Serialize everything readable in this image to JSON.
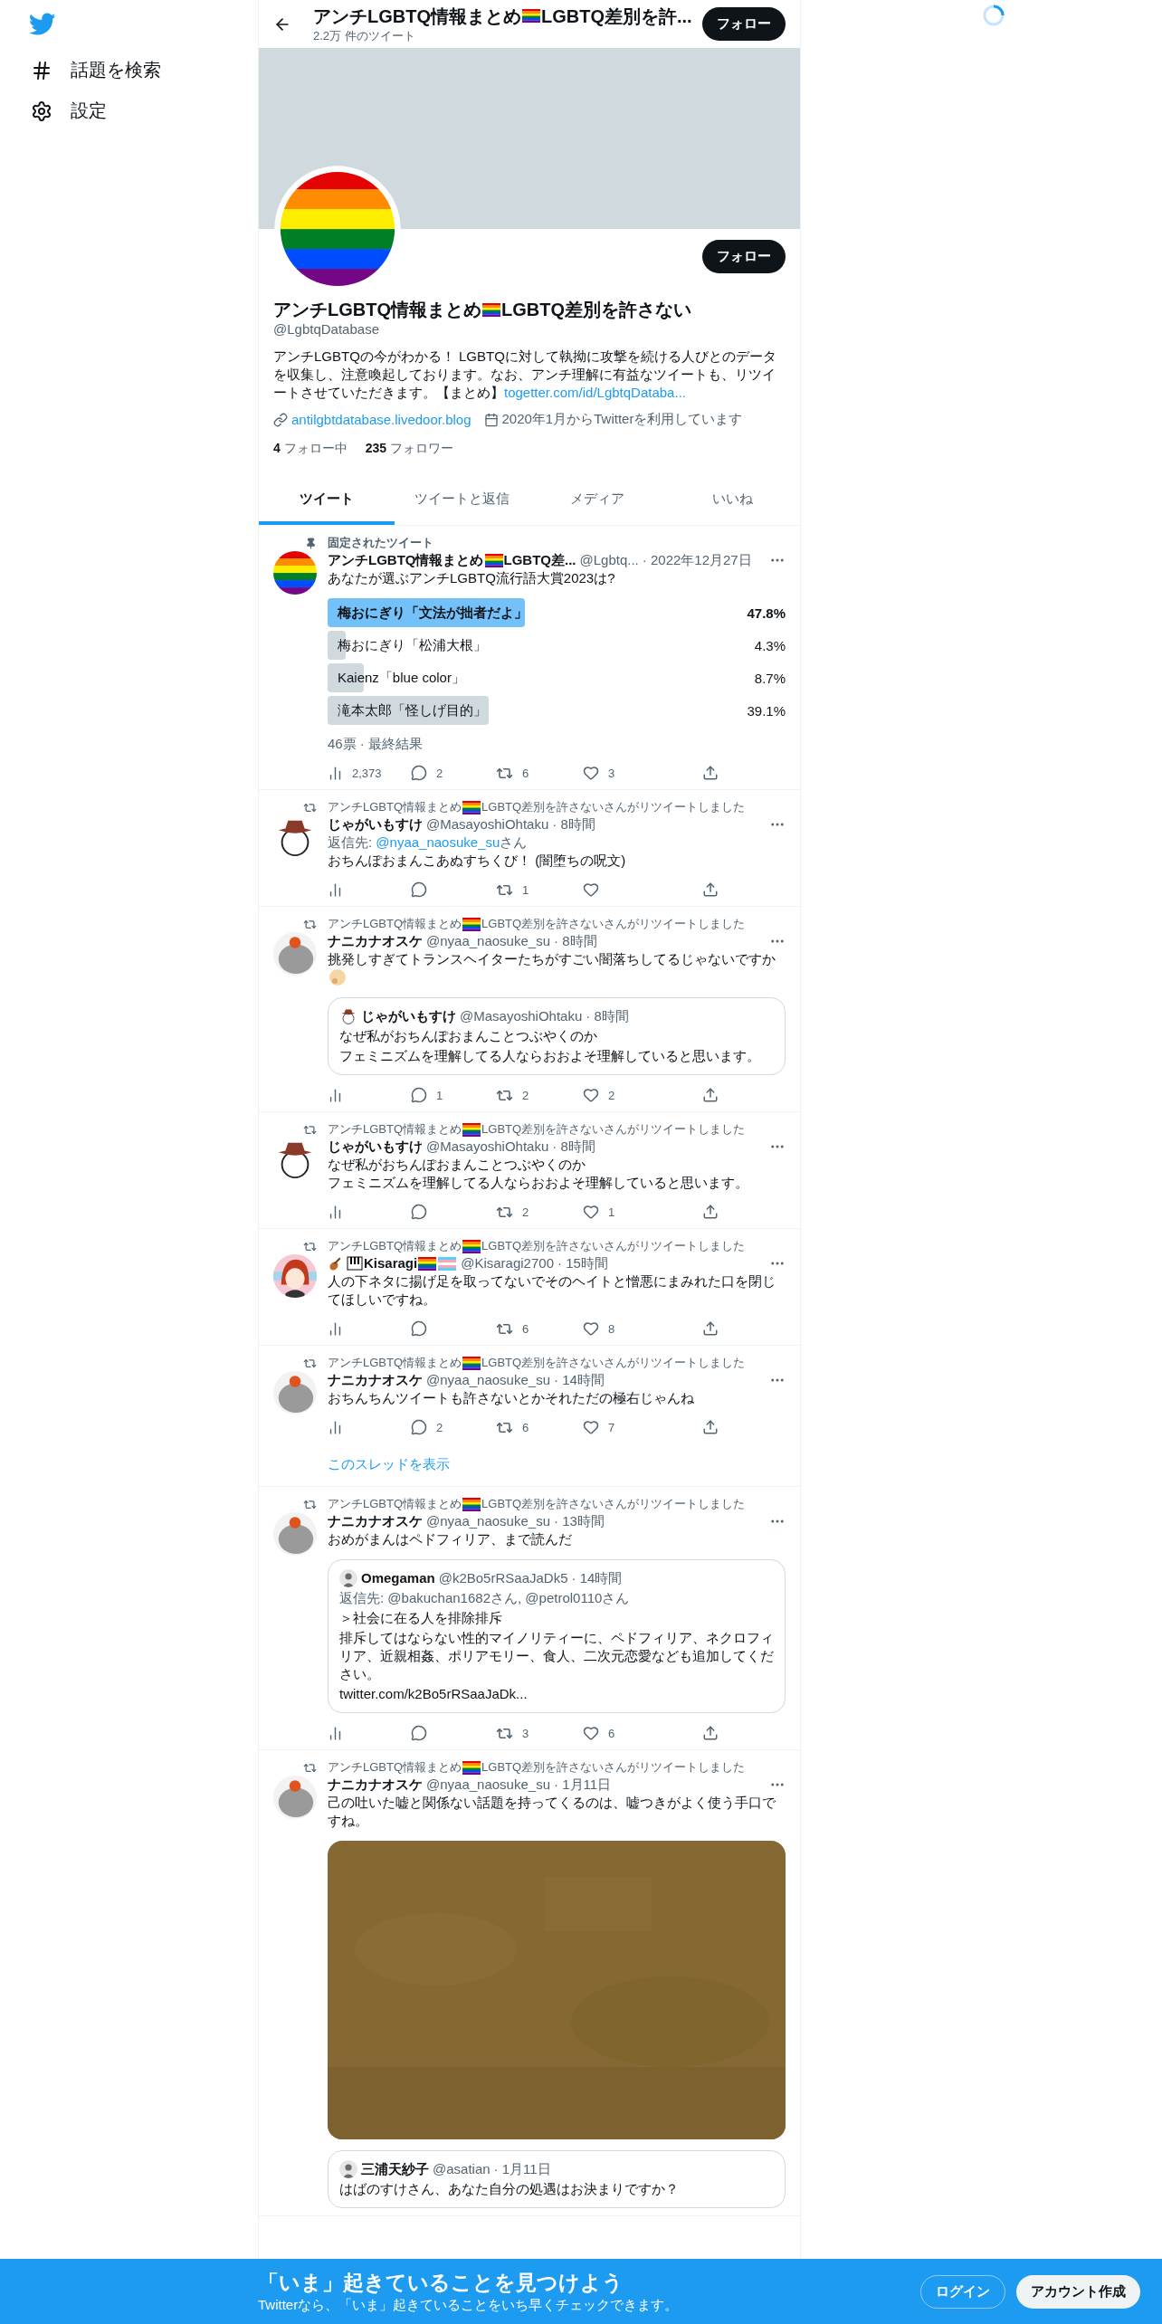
{
  "sidebar": {
    "items": [
      {
        "kind": "hash",
        "label": "話題を検索"
      },
      {
        "kind": "gear",
        "label": "設定"
      }
    ]
  },
  "header": {
    "title": [
      "アンチLGBTQ情報まとめ",
      {
        "kind": "rainbow-flag"
      },
      "LGBTQ差別を許..."
    ],
    "subtitle": "2.2万 件のツイート",
    "follow": "フォロー"
  },
  "profile": {
    "follow": "フォロー",
    "name": [
      "アンチLGBTQ情報まとめ",
      {
        "kind": "rainbow-flag"
      },
      "LGBTQ差別を許さない"
    ],
    "handle": "@LgbtqDatabase",
    "bio": "アンチLGBTQの今がわかる！ LGBTQに対して執拗に攻撃を続ける人びとのデータを収集し、注意喚起しております。なお、アンチ理解に有益なツイートも、リツイートさせていただきます。【まとめ】",
    "bio_link": "togetter.com/id/LgbtqDataba...",
    "website": "antilgbtdatabase.livedoor.blog",
    "joined": "2020年1月からTwitterを利用しています",
    "stats": [
      {
        "count": "4",
        "label": "フォロー中"
      },
      {
        "count": "235",
        "label": "フォロワー"
      }
    ]
  },
  "tabs": [
    {
      "label": "ツイート",
      "selected": true
    },
    {
      "label": "ツイートと返信",
      "selected": false
    },
    {
      "label": "メディア",
      "selected": false
    },
    {
      "label": "いいね",
      "selected": false
    }
  ],
  "tweets": [
    {
      "context": {
        "kind": "pinned",
        "label": [
          "固定されたツイート"
        ]
      },
      "avatar": {
        "kind": "rainbow"
      },
      "name": [
        "アンチLGBTQ情報まとめ",
        {
          "kind": "rainbow-flag"
        },
        "LGBTQ差..."
      ],
      "handle": "@Lgbtq...",
      "time": "· 2022年12月27日",
      "lines": [
        "あなたが選ぶアンチLGBTQ流行語大賞2023は?"
      ],
      "poll": {
        "options": [
          {
            "label": "梅おにぎり「文法が拙者だよ」",
            "percent": "47.8%",
            "selected": true
          },
          {
            "label": "梅おにぎり「松浦大根」",
            "percent": "4.3%",
            "selected": false
          },
          {
            "label": "Kaienz「blue color」",
            "percent": "8.7%",
            "selected": false
          },
          {
            "label": "滝本太郎「怪しげ目的」",
            "percent": "39.1%",
            "selected": false
          }
        ],
        "footer": "46票 · 最終結果"
      },
      "stats": {
        "views": "2,373",
        "replies": "2",
        "retweets": "6",
        "likes": "3"
      }
    },
    {
      "context": {
        "kind": "retweet",
        "label": [
          "アンチLGBTQ情報まとめ",
          {
            "kind": "rainbow-flag"
          },
          "LGBTQ差別を許さないさんがリツイートしました"
        ]
      },
      "avatar": {
        "kind": "cowboy"
      },
      "name": [
        "じゃがいもすけ"
      ],
      "handle": "@MasayoshiOhtaku",
      "time": "· 8時間",
      "reply_to": {
        "prefix": "返信先: ",
        "handle": "@nyaa_naosuke_su",
        "suffix": "さん"
      },
      "lines": [
        "おちんぽおまんこあぬすちくび！ (闇堕ちの呪文)"
      ],
      "stats": {
        "retweets": "1"
      }
    },
    {
      "context": {
        "kind": "retweet",
        "label": [
          "アンチLGBTQ情報まとめ",
          {
            "kind": "rainbow-flag"
          },
          "LGBTQ差別を許さないさんがリツイートしました"
        ]
      },
      "avatar": {
        "kind": "gray-cat"
      },
      "name": [
        "ナニカナオスケ"
      ],
      "handle": "@nyaa_naosuke_su",
      "time": "· 8時間",
      "lines": [
        "挑発しすぎてトランスヘイターたちがすごい闇落ちしてるじゃないですか"
      ],
      "text_emoji": {
        "kind": "thinking"
      },
      "quote": {
        "avatar": {
          "kind": "cowboy"
        },
        "name": "じゃがいもすけ",
        "handle": "@MasayoshiOhtaku",
        "time": "· 8時間",
        "lines": [
          "なぜ私がおちんぽおまんことつぶやくのか",
          "フェミニズムを理解してる人ならおおよそ理解していると思います。"
        ]
      },
      "stats": {
        "replies": "1",
        "retweets": "2",
        "likes": "2"
      }
    },
    {
      "context": {
        "kind": "retweet",
        "label": [
          "アンチLGBTQ情報まとめ",
          {
            "kind": "rainbow-flag"
          },
          "LGBTQ差別を許さないさんがリツイートしました"
        ]
      },
      "avatar": {
        "kind": "cowboy"
      },
      "name": [
        "じゃがいもすけ"
      ],
      "handle": "@MasayoshiOhtaku",
      "time": "· 8時間",
      "lines": [
        "なぜ私がおちんぽおまんことつぶやくのか",
        "フェミニズムを理解してる人ならおおよそ理解していると思います。"
      ],
      "stats": {
        "retweets": "2",
        "likes": "1"
      }
    },
    {
      "context": {
        "kind": "retweet",
        "label": [
          "アンチLGBTQ情報まとめ",
          {
            "kind": "rainbow-flag"
          },
          "LGBTQ差別を許さないさんがリツイートしました"
        ]
      },
      "avatar": {
        "kind": "anime"
      },
      "name": [
        {
          "kind": "violin"
        },
        {
          "kind": "piano"
        },
        "Kisaragi",
        {
          "kind": "rainbow-flag"
        },
        {
          "kind": "trans-flag"
        }
      ],
      "handle": "@Kisaragi2700",
      "time": "· 15時間",
      "lines": [
        "人の下ネタに揚げ足を取ってないでそのヘイトと憎悪にまみれた口を閉じてほしいですね。"
      ],
      "stats": {
        "retweets": "6",
        "likes": "8"
      }
    },
    {
      "context": {
        "kind": "retweet",
        "label": [
          "アンチLGBTQ情報まとめ",
          {
            "kind": "rainbow-flag"
          },
          "LGBTQ差別を許さないさんがリツイートしました"
        ]
      },
      "avatar": {
        "kind": "gray-cat"
      },
      "name": [
        "ナニカナオスケ"
      ],
      "handle": "@nyaa_naosuke_su",
      "time": "· 14時間",
      "lines": [
        "おちんちんツイートも許さないとかそれただの極右じゃんね"
      ],
      "stats": {
        "replies": "2",
        "retweets": "6",
        "likes": "7"
      },
      "show_thread": "このスレッドを表示"
    },
    {
      "context": {
        "kind": "retweet",
        "label": [
          "アンチLGBTQ情報まとめ",
          {
            "kind": "rainbow-flag"
          },
          "LGBTQ差別を許さないさんがリツイートしました"
        ]
      },
      "avatar": {
        "kind": "gray-cat"
      },
      "name": [
        "ナニカナオスケ"
      ],
      "handle": "@nyaa_naosuke_su",
      "time": "· 13時間",
      "lines": [
        "おめがまんはペドフィリア、まで読んだ"
      ],
      "quote": {
        "avatar": {
          "kind": "person"
        },
        "name": "Omegaman",
        "handle": "@k2Bo5rRSaaJaDk5",
        "time": "· 14時間",
        "reply_line": "返信先: @bakuchan1682さん, @petrol0110さん",
        "lines": [
          "＞社会に在る人を排除排斥",
          "排斥してはならない性的マイノリティーに、ペドフィリア、ネクロフィリア、近親相姦、ポリアモリー、食人、二次元恋愛なども追加してください。"
        ],
        "link": "twitter.com/k2Bo5rRSaaJaDk..."
      },
      "stats": {
        "retweets": "3",
        "likes": "6"
      }
    },
    {
      "context": {
        "kind": "retweet",
        "label": [
          "アンチLGBTQ情報まとめ",
          {
            "kind": "rainbow-flag"
          },
          "LGBTQ差別を許さないさんがリツイートしました"
        ]
      },
      "avatar": {
        "kind": "gray-cat"
      },
      "name": [
        "ナニカナオスケ"
      ],
      "handle": "@nyaa_naosuke_su",
      "time": "· 1月11日",
      "lines": [
        "己の吐いた嘘と関係ない話題を持ってくるのは、嘘つきがよく使う手口ですね。"
      ],
      "media": {
        "kind": "picture"
      },
      "quote": {
        "avatar": {
          "kind": "person"
        },
        "name": "三浦天紗子",
        "handle": "@asatian",
        "time": "· 1月11日",
        "lines": [
          "はばのすけさん、あなた自分の処遇はお決まりですか？"
        ]
      }
    }
  ],
  "banner": {
    "title": "「いま」起きていることを見つけよう",
    "subtitle": "Twitterなら、「いま」起きていることをいち早くチェックできます。",
    "login": "ログイン",
    "signup": "アカウント作成"
  }
}
